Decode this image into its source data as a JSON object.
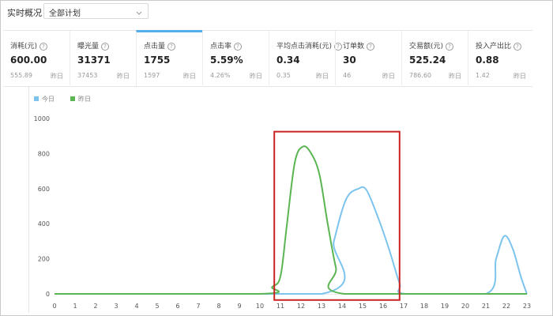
{
  "header": {
    "title": "实时概况",
    "plan_select": {
      "value": "全部计划",
      "icon": "chevron-down-icon"
    }
  },
  "metrics": [
    {
      "label": "消耗(元)",
      "value": "600.00",
      "prev_value": "555.89",
      "prev_label": "昨日",
      "active": false
    },
    {
      "label": "曝光量",
      "value": "31371",
      "prev_value": "37453",
      "prev_label": "昨日",
      "active": false
    },
    {
      "label": "点击量",
      "value": "1755",
      "prev_value": "1597",
      "prev_label": "昨日",
      "active": true
    },
    {
      "label": "点击率",
      "value": "5.59%",
      "prev_value": "4.26%",
      "prev_label": "昨日",
      "active": false
    },
    {
      "label": "平均点击消耗(元)",
      "value": "0.34",
      "prev_value": "0.35",
      "prev_label": "昨日",
      "active": false
    },
    {
      "label": "订单数",
      "value": "30",
      "prev_value": "46",
      "prev_label": "昨日",
      "active": false
    },
    {
      "label": "交易额(元)",
      "value": "525.24",
      "prev_value": "786.60",
      "prev_label": "昨日",
      "active": false
    },
    {
      "label": "投入产出比",
      "value": "0.88",
      "prev_value": "1.42",
      "prev_label": "昨日",
      "active": false
    }
  ],
  "chart_data": {
    "type": "line",
    "x": [
      0,
      1,
      2,
      3,
      4,
      5,
      6,
      7,
      8,
      9,
      10,
      11,
      12,
      13,
      14,
      15,
      16,
      17,
      18,
      19,
      20,
      21,
      22,
      23
    ],
    "x_ticks": [
      "0",
      "1",
      "2",
      "3",
      "4",
      "5",
      "6",
      "7",
      "8",
      "9",
      "10",
      "11",
      "12",
      "13",
      "14",
      "15",
      "16",
      "17",
      "18",
      "19",
      "20",
      "21",
      "22",
      "23"
    ],
    "y_ticks": [
      "0",
      "200",
      "400",
      "600",
      "800",
      "1000"
    ],
    "ylim": [
      0,
      1000
    ],
    "legend_position": "top-left",
    "grid": false,
    "series": [
      {
        "name": "今日",
        "color": "#7cc4ee",
        "points": [
          [
            0,
            0
          ],
          [
            13,
            0
          ],
          [
            13.6,
            300
          ],
          [
            14.2,
            540
          ],
          [
            14.8,
            600
          ],
          [
            15.2,
            590
          ],
          [
            15.8,
            420
          ],
          [
            16.3,
            250
          ],
          [
            16.8,
            60
          ],
          [
            17.1,
            0
          ],
          [
            21,
            0
          ],
          [
            21.5,
            200
          ],
          [
            21.9,
            330
          ],
          [
            22.3,
            260
          ],
          [
            22.7,
            100
          ],
          [
            23,
            0
          ]
        ]
      },
      {
        "name": "昨日",
        "color": "#5ab552",
        "points": [
          [
            0,
            0
          ],
          [
            10,
            0
          ],
          [
            10.6,
            40
          ],
          [
            11,
            100
          ],
          [
            11.3,
            380
          ],
          [
            11.7,
            750
          ],
          [
            12.1,
            840
          ],
          [
            12.5,
            800
          ],
          [
            12.9,
            680
          ],
          [
            13.3,
            400
          ],
          [
            13.7,
            150
          ],
          [
            14.1,
            0
          ],
          [
            23,
            0
          ]
        ]
      }
    ],
    "highlight_box": {
      "x_range": [
        10.7,
        16.8
      ],
      "y_range": [
        -35,
        925
      ],
      "color": "#cc2222"
    }
  }
}
